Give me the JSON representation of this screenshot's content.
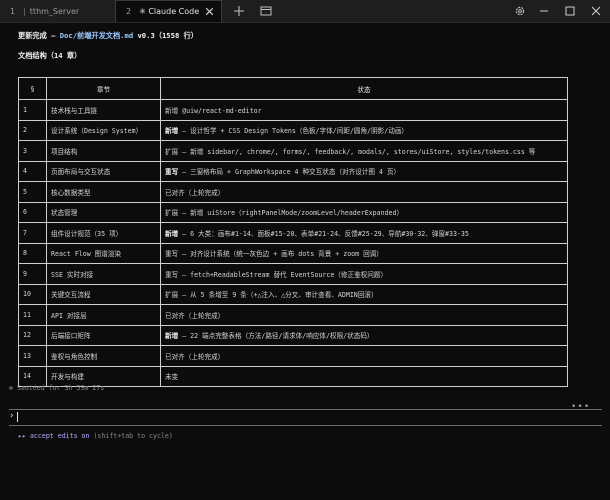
{
  "tabs": [
    {
      "num": "1",
      "title": "tthm_Server"
    },
    {
      "num": "2",
      "title": "✳ Claude Code"
    }
  ],
  "header": {
    "update_prefix": "更新完成 — ",
    "update_file": "Doc/前端开发文档.md",
    "update_suffix": " v0.3（1558 行）",
    "structure": "文档结构（14 章）"
  },
  "table": {
    "headers": [
      "§",
      "章节",
      "状态"
    ],
    "rows": [
      {
        "n": "1",
        "chapter": "技术栈与工具链",
        "lead": "",
        "status": "新增 @uiw/react-md-editor"
      },
      {
        "n": "2",
        "chapter": "设计系统（Design System）",
        "lead": "新增",
        "status": " — 设计哲学 + CSS Design Tokens（色板/字体/间距/圆角/阴影/动画）"
      },
      {
        "n": "3",
        "chapter": "项目结构",
        "lead": "",
        "status": "扩展 — 新增 sidebar/, chrome/, forms/, feedback/, modals/, stores/uiStore, styles/tokens.css 等"
      },
      {
        "n": "4",
        "chapter": "页面布局与交互状态",
        "lead": "重写",
        "status": " — 三窗格布局 + GraphWorkspace 4 种交互状态（对齐设计图 4 页）"
      },
      {
        "n": "5",
        "chapter": "核心数据类型",
        "lead": "",
        "status": "已对齐（上轮完成）"
      },
      {
        "n": "6",
        "chapter": "状态管理",
        "lead": "",
        "status": "扩展 — 新增 uiStore（rightPanelMode/zoomLevel/headerExpanded）"
      },
      {
        "n": "7",
        "chapter": "组件设计规范（35 项）",
        "lead": "新增",
        "status": " — 6 大类：画布#1-14、面板#15-20、表单#21-24、反馈#25-29、导航#30-32、弹窗#33-35"
      },
      {
        "n": "8",
        "chapter": "React Flow 图谱渲染",
        "lead": "",
        "status": "重写 — 对齐设计系统（统一灰色边 + 画布 dots 背景 + zoom 回调）"
      },
      {
        "n": "9",
        "chapter": "SSE 实时对接",
        "lead": "",
        "status": "重写 — fetch+ReadableStream 替代 EventSource（修正鉴权问题）"
      },
      {
        "n": "10",
        "chapter": "关键交互流程",
        "lead": "",
        "status": "扩展 — 从 5 条增至 9 条（+△注入、△分叉、审计查看、ADMIN回滚）"
      },
      {
        "n": "11",
        "chapter": "API 对接层",
        "lead": "",
        "status": "已对齐（上轮完成）"
      },
      {
        "n": "12",
        "chapter": "后端接口矩阵",
        "lead": "新增",
        "status": " — 22 端点完整表格（方法/路径/请求体/响应体/权限/状态码）"
      },
      {
        "n": "13",
        "chapter": "鉴权与角色控制",
        "lead": "",
        "status": "已对齐（上轮完成）"
      },
      {
        "n": "14",
        "chapter": "开发与构建",
        "lead": "",
        "status": "未变"
      }
    ]
  },
  "sauteed": "✻ Sautéed for 3h 59m 27s",
  "prompt": {
    "caret": "›",
    "dots": "•••"
  },
  "accept": {
    "arrows": "▸▸",
    "label": "accept edits on",
    "hint": " (shift+tab to cycle)"
  }
}
